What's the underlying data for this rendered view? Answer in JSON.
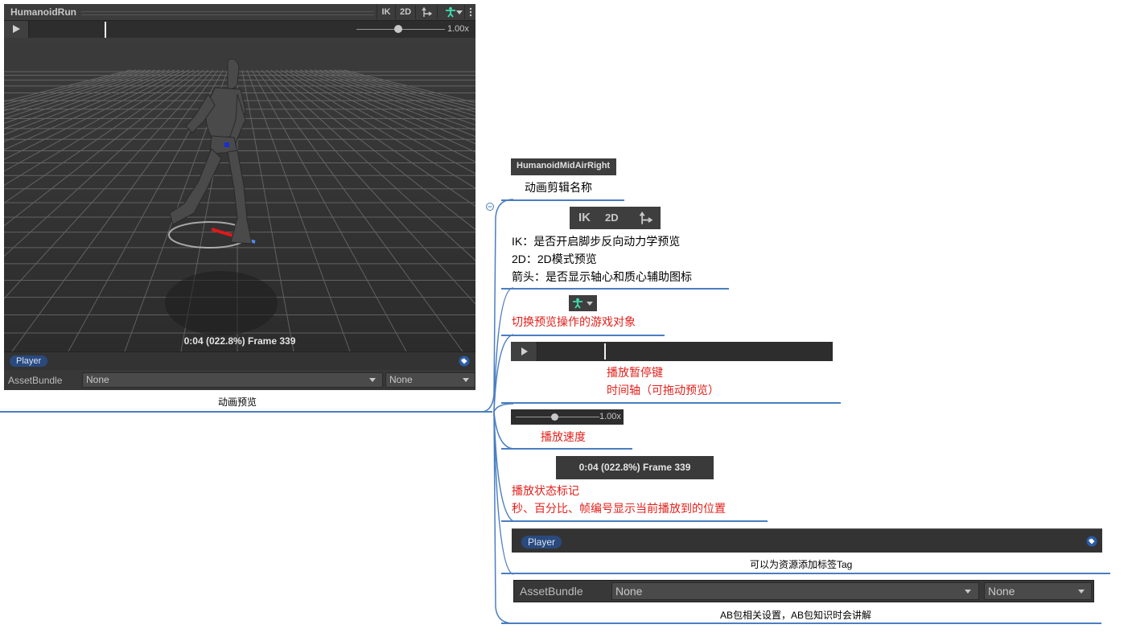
{
  "preview": {
    "title": "HumanoidRun",
    "toolbar": {
      "ik": "IK",
      "mode2d": "2D",
      "pivot_icon": "pivot-arrows-icon",
      "avatar_icon": "avatar-figure-icon",
      "menu_icon": "vertical-ellipsis-icon"
    },
    "speed": "1.00x",
    "status": "0:04 (022.8%) Frame 339",
    "tag": "Player",
    "assetbundle": {
      "label": "AssetBundle",
      "name": "None",
      "variant": "None"
    }
  },
  "caption": "动画预览",
  "annotations": {
    "clip_chip": "HumanoidMidAirRight",
    "clip_label": "动画剪辑名称",
    "ik_btn": "IK",
    "d2_btn": "2D",
    "ik_desc": "IK：是否开启脚步反向动力学预览",
    "d2_desc": "2D：2D模式预览",
    "arrow_desc": "箭头：是否显示轴心和质心辅助图标",
    "switch_desc": "切换预览操作的游戏对象",
    "play_desc": "播放暂停键",
    "timeline_desc": "时间轴（可拖动预览）",
    "speed_value": "1.00x",
    "speed_desc": "播放速度",
    "status_chip": "0:04 (022.8%) Frame 339",
    "status_desc1": "播放状态标记",
    "status_desc2": "秒、百分比、帧编号显示当前播放到的位置",
    "tag_pill": "Player",
    "tag_desc": "可以为资源添加标签Tag",
    "ab_label": "AssetBundle",
    "ab_name": "None",
    "ab_variant": "None",
    "ab_desc": "AB包相关设置，AB包知识时会讲解"
  },
  "colors": {
    "accent_red": "#e3201b",
    "line_blue": "#4a7ec0",
    "avatar_green": "#3fe0b0",
    "tag_blue": "#2a4a7e"
  }
}
